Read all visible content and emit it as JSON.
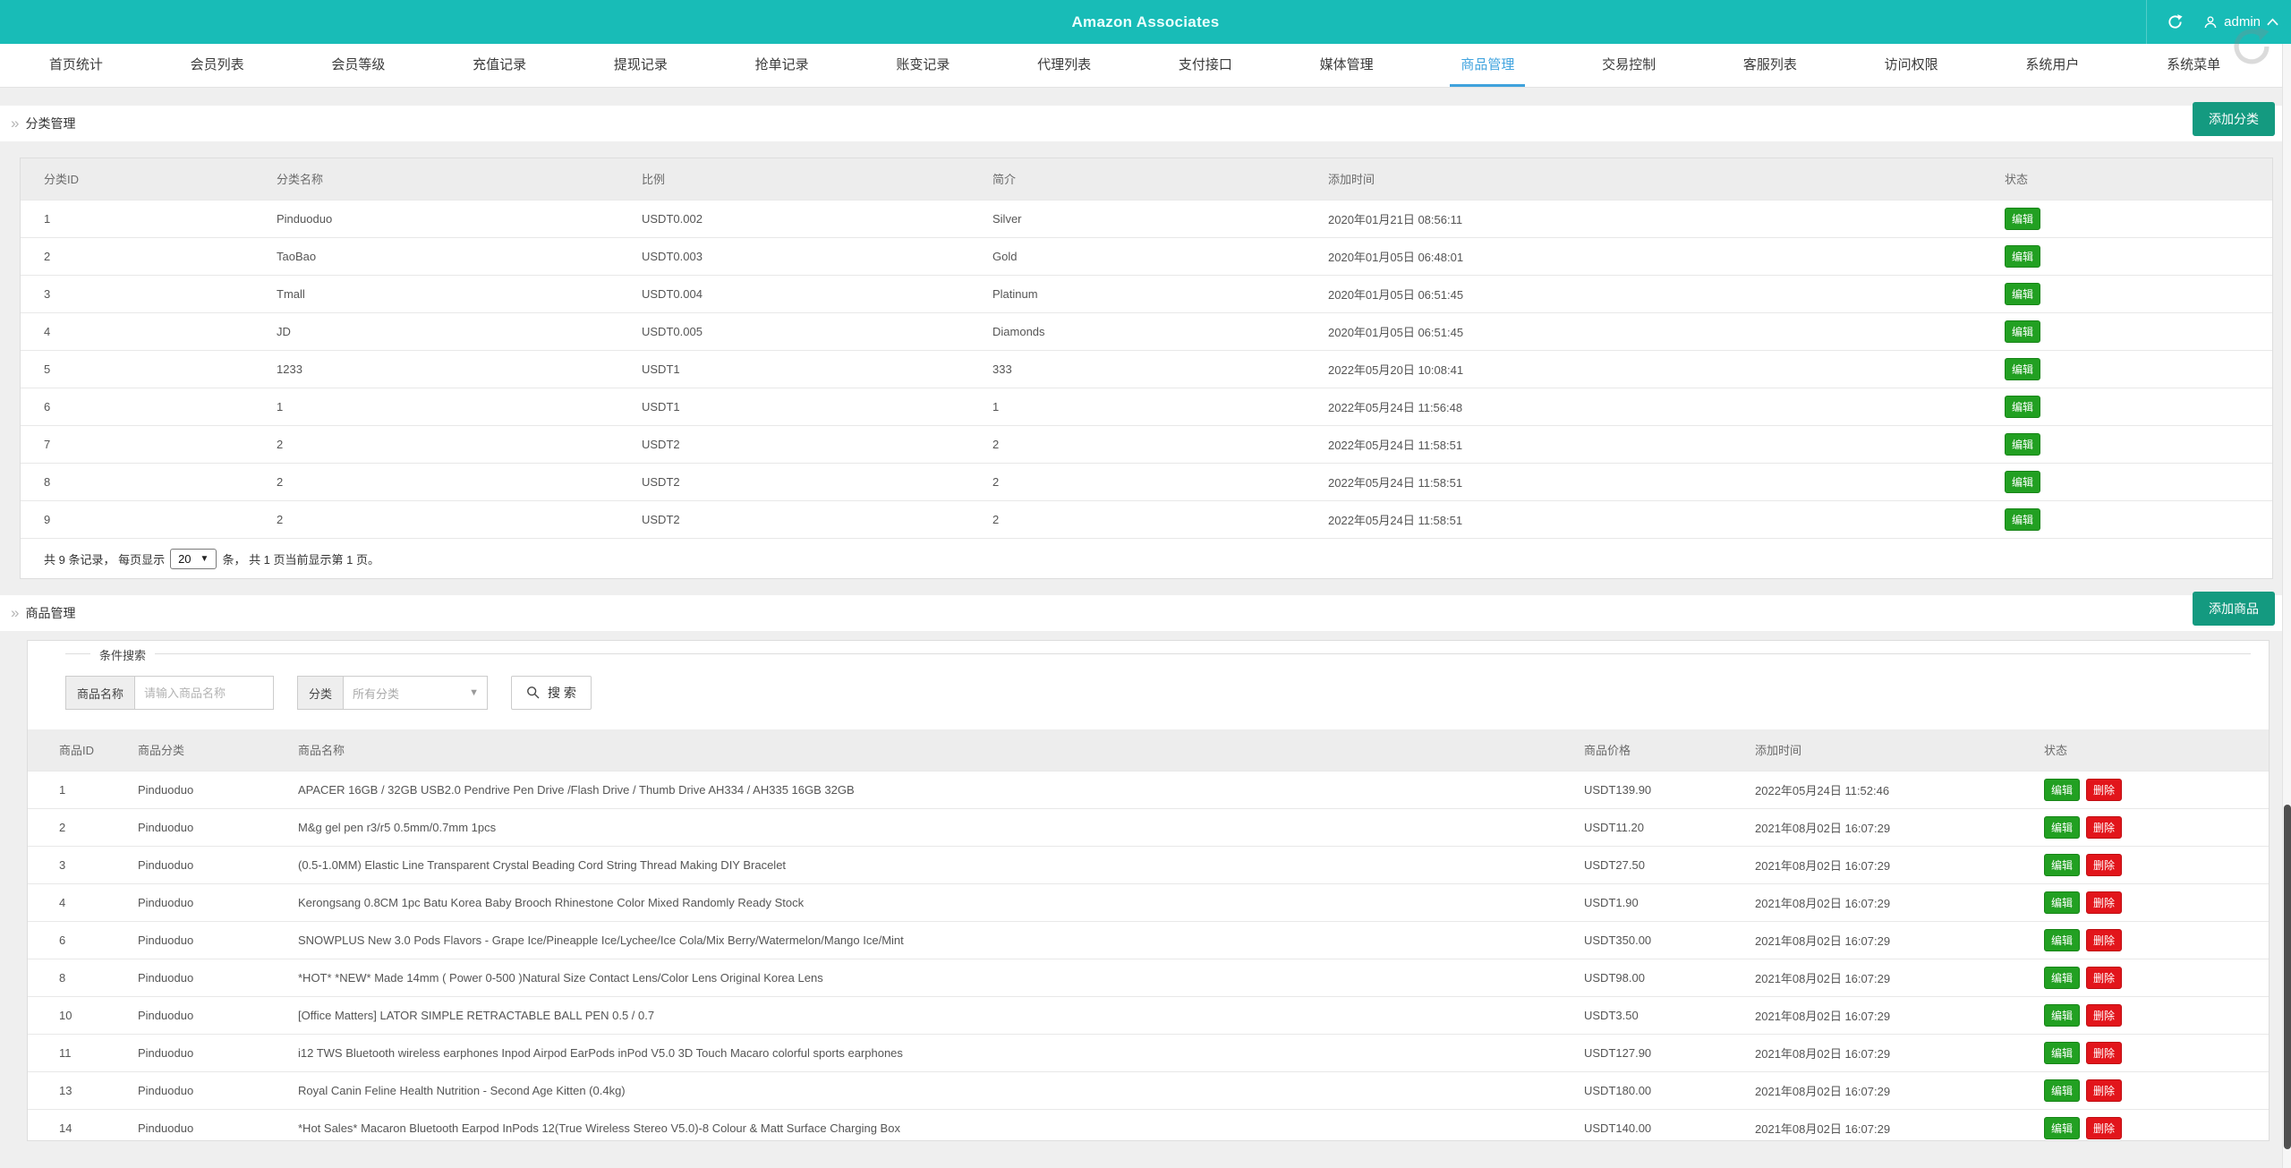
{
  "colors": {
    "header_teal": "#18bcb7",
    "active_tab_blue": "#42a4df",
    "add_button_green": "#149a80",
    "edit_green": "#22a022",
    "delete_red": "#e2151b"
  },
  "header": {
    "title": "Amazon Associates",
    "username": "admin"
  },
  "nav": {
    "items": [
      {
        "label": "首页统计",
        "active": false
      },
      {
        "label": "会员列表",
        "active": false
      },
      {
        "label": "会员等级",
        "active": false
      },
      {
        "label": "充值记录",
        "active": false
      },
      {
        "label": "提现记录",
        "active": false
      },
      {
        "label": "抢单记录",
        "active": false
      },
      {
        "label": "账变记录",
        "active": false
      },
      {
        "label": "代理列表",
        "active": false
      },
      {
        "label": "支付接口",
        "active": false
      },
      {
        "label": "媒体管理",
        "active": false
      },
      {
        "label": "商品管理",
        "active": true
      },
      {
        "label": "交易控制",
        "active": false
      },
      {
        "label": "客服列表",
        "active": false
      },
      {
        "label": "访问权限",
        "active": false
      },
      {
        "label": "系统用户",
        "active": false
      },
      {
        "label": "系统菜单",
        "active": false
      }
    ]
  },
  "labels": {
    "edit": "编辑",
    "delete": "删除"
  },
  "category_section": {
    "breadcrumb": "分类管理",
    "add_button": "添加分类",
    "table": {
      "headers": [
        "分类ID",
        "分类名称",
        "比例",
        "简介",
        "添加时间",
        "状态"
      ],
      "rows": [
        [
          "1",
          "Pinduoduo",
          "USDT0.002",
          "Silver",
          "2020年01月21日 08:56:11"
        ],
        [
          "2",
          "TaoBao",
          "USDT0.003",
          "Gold",
          "2020年01月05日 06:48:01"
        ],
        [
          "3",
          "Tmall",
          "USDT0.004",
          "Platinum",
          "2020年01月05日 06:51:45"
        ],
        [
          "4",
          "JD",
          "USDT0.005",
          "Diamonds",
          "2020年01月05日 06:51:45"
        ],
        [
          "5",
          "1233",
          "USDT1",
          "333",
          "2022年05月20日 10:08:41"
        ],
        [
          "6",
          "1",
          "USDT1",
          "1",
          "2022年05月24日 11:56:48"
        ],
        [
          "7",
          "2",
          "USDT2",
          "2",
          "2022年05月24日 11:58:51"
        ],
        [
          "8",
          "2",
          "USDT2",
          "2",
          "2022年05月24日 11:58:51"
        ],
        [
          "9",
          "2",
          "USDT2",
          "2",
          "2022年05月24日 11:58:51"
        ]
      ]
    },
    "pagination": {
      "prefix": "共 9 条记录， 每页显示",
      "page_size": "20",
      "suffix": "条， 共 1 页当前显示第 1 页。"
    }
  },
  "product_section": {
    "breadcrumb": "商品管理",
    "add_button": "添加商品",
    "search": {
      "legend": "条件搜索",
      "name_label": "商品名称",
      "name_placeholder": "请输入商品名称",
      "category_label": "分类",
      "category_value": "所有分类",
      "search_button": "搜 索"
    },
    "table": {
      "headers": [
        "商品ID",
        "商品分类",
        "商品名称",
        "商品价格",
        "添加时间",
        "状态"
      ],
      "rows": [
        [
          "1",
          "Pinduoduo",
          "APACER 16GB / 32GB USB2.0 Pendrive Pen Drive /Flash Drive / Thumb Drive AH334 / AH335 16GB 32GB",
          "USDT139.90",
          "2022年05月24日 11:52:46"
        ],
        [
          "2",
          "Pinduoduo",
          "M&g gel pen r3/r5 0.5mm/0.7mm 1pcs",
          "USDT11.20",
          "2021年08月02日 16:07:29"
        ],
        [
          "3",
          "Pinduoduo",
          "(0.5-1.0MM) Elastic Line Transparent Crystal Beading Cord String Thread Making DIY Bracelet",
          "USDT27.50",
          "2021年08月02日 16:07:29"
        ],
        [
          "4",
          "Pinduoduo",
          "Kerongsang 0.8CM 1pc Batu Korea Baby Brooch Rhinestone Color Mixed Randomly Ready Stock",
          "USDT1.90",
          "2021年08月02日 16:07:29"
        ],
        [
          "6",
          "Pinduoduo",
          "SNOWPLUS New 3.0 Pods Flavors - Grape Ice/Pineapple Ice/Lychee/Ice Cola/Mix Berry/Watermelon/Mango Ice/Mint",
          "USDT350.00",
          "2021年08月02日 16:07:29"
        ],
        [
          "8",
          "Pinduoduo",
          "*HOT* *NEW* Made 14mm ( Power 0-500 )Natural Size Contact Lens/Color Lens Original Korea Lens",
          "USDT98.00",
          "2021年08月02日 16:07:29"
        ],
        [
          "10",
          "Pinduoduo",
          "[Office Matters] LATOR SIMPLE RETRACTABLE BALL PEN 0.5 / 0.7",
          "USDT3.50",
          "2021年08月02日 16:07:29"
        ],
        [
          "11",
          "Pinduoduo",
          "i12 TWS Bluetooth wireless earphones Inpod Airpod EarPods inPod V5.0 3D Touch Macaro colorful sports earphones",
          "USDT127.90",
          "2021年08月02日 16:07:29"
        ],
        [
          "13",
          "Pinduoduo",
          "Royal Canin Feline Health Nutrition - Second Age Kitten (0.4kg)",
          "USDT180.00",
          "2021年08月02日 16:07:29"
        ],
        [
          "14",
          "Pinduoduo",
          "*Hot Sales* Macaron Bluetooth Earpod InPods 12(True Wireless Stereo V5.0)-8 Colour & Matt Surface Charging Box",
          "USDT140.00",
          "2021年08月02日 16:07:29"
        ]
      ]
    }
  }
}
